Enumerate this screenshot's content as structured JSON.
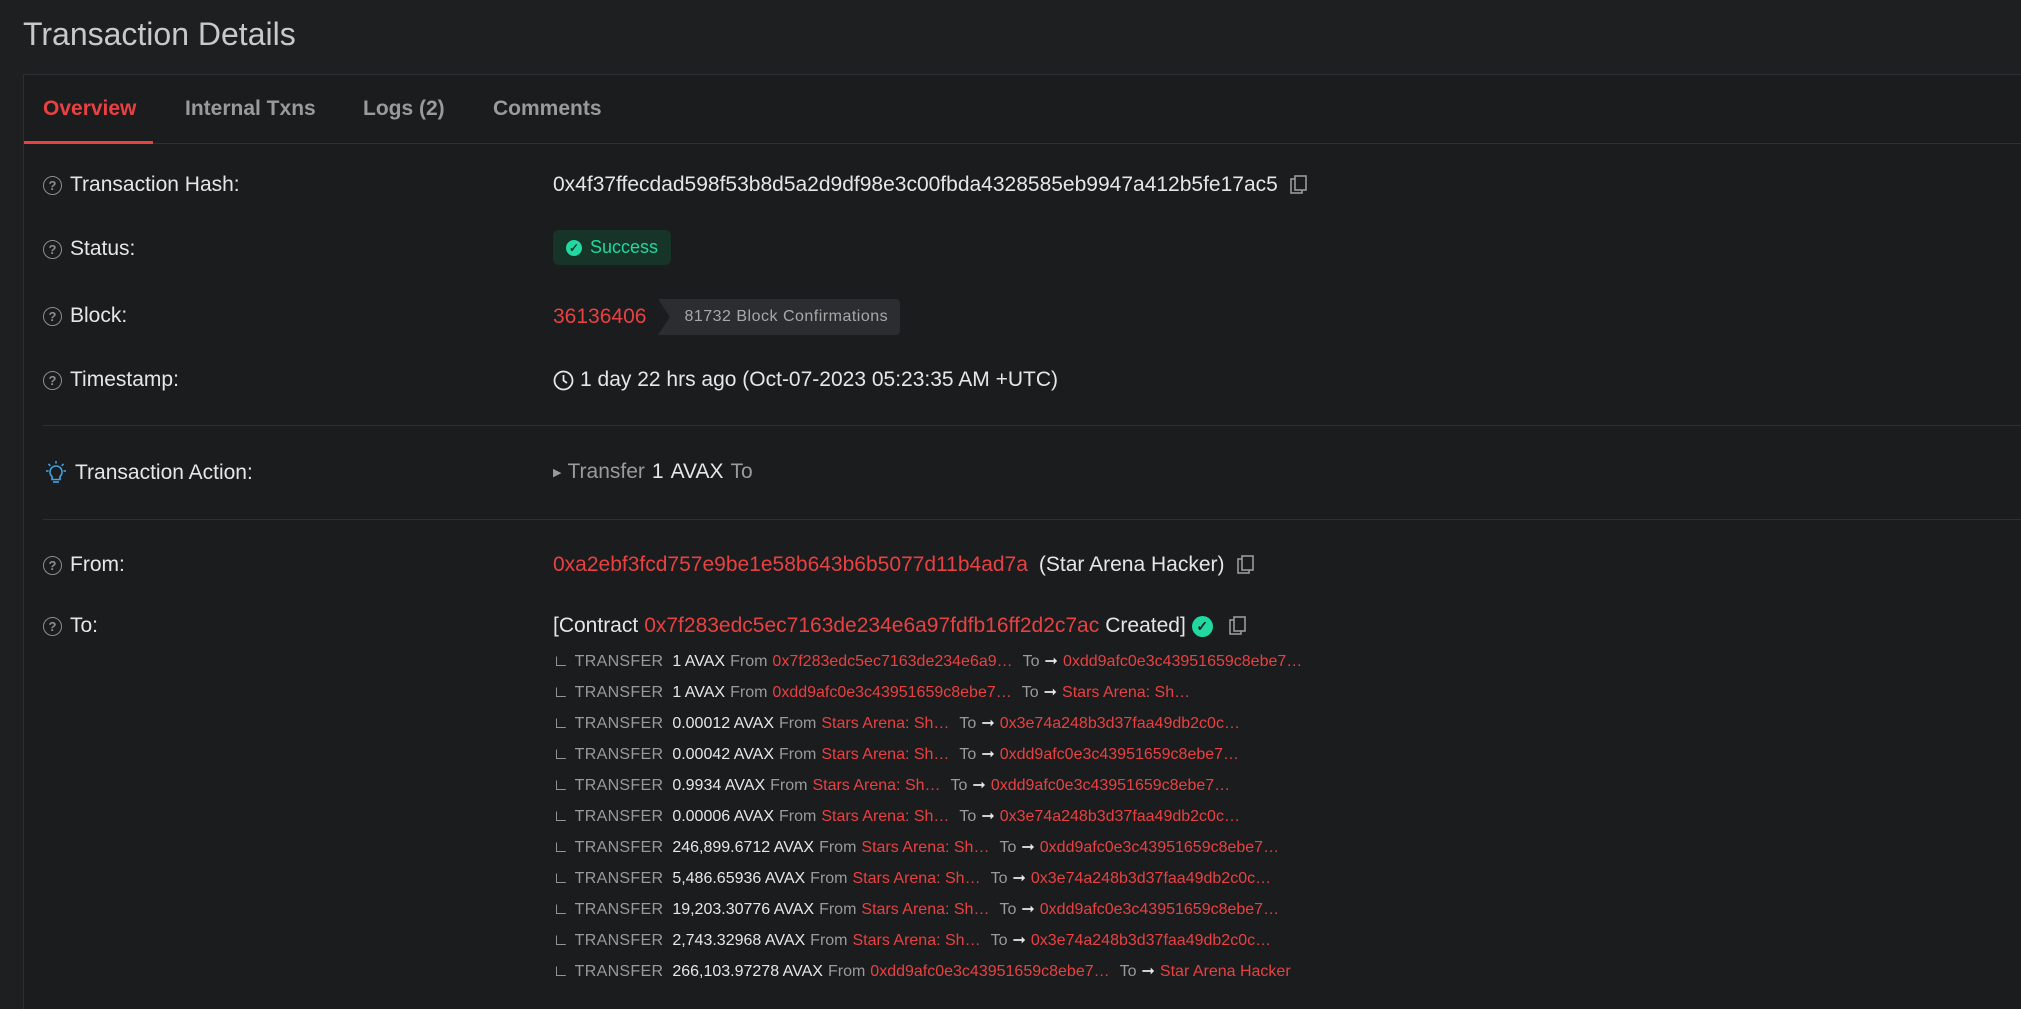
{
  "page": {
    "title": "Transaction Details"
  },
  "tabs": [
    {
      "label": "Overview"
    },
    {
      "label": "Internal Txns"
    },
    {
      "label": "Logs (2)"
    },
    {
      "label": "Comments"
    }
  ],
  "fields": {
    "hash": {
      "label": "Transaction Hash:",
      "value": "0x4f37ffecdad598f53b8d5a2d9df98e3c00fbda4328585eb9947a412b5fe17ac5"
    },
    "status": {
      "label": "Status:",
      "value": "Success"
    },
    "block": {
      "label": "Block:",
      "number": "36136406",
      "confirmations": "81732 Block Confirmations"
    },
    "timestamp": {
      "label": "Timestamp:",
      "value": "1 day 22 hrs ago (Oct-07-2023 05:23:35 AM +UTC)"
    },
    "action": {
      "label": "Transaction Action:",
      "verb": "Transfer",
      "amount": "1",
      "token": "AVAX",
      "to": "To"
    },
    "from": {
      "label": "From:",
      "address": "0xa2ebf3fcd757e9be1e58b643b6b5077d11b4ad7a",
      "name": "(Star Arena Hacker)"
    },
    "to": {
      "label": "To:",
      "prefix": "[Contract",
      "address": "0x7f283edc5ec7163de234e6a97fdfb16ff2d2c7ac",
      "suffix": "Created]"
    }
  },
  "transfers": [
    {
      "kind": "TRANSFER",
      "amount": "1 AVAX",
      "from": "0x7f283edc5ec7163de234e6a9…",
      "to": "0xdd9afc0e3c43951659c8ebe7…"
    },
    {
      "kind": "TRANSFER",
      "amount": "1 AVAX",
      "from": "0xdd9afc0e3c43951659c8ebe7…",
      "to": "Stars Arena: Sh…"
    },
    {
      "kind": "TRANSFER",
      "amount": "0.00012 AVAX",
      "from": "Stars Arena: Sh…",
      "to": "0x3e74a248b3d37faa49db2c0c…"
    },
    {
      "kind": "TRANSFER",
      "amount": "0.00042 AVAX",
      "from": "Stars Arena: Sh…",
      "to": "0xdd9afc0e3c43951659c8ebe7…"
    },
    {
      "kind": "TRANSFER",
      "amount": "0.9934 AVAX",
      "from": "Stars Arena: Sh…",
      "to": "0xdd9afc0e3c43951659c8ebe7…"
    },
    {
      "kind": "TRANSFER",
      "amount": "0.00006 AVAX",
      "from": "Stars Arena: Sh…",
      "to": "0x3e74a248b3d37faa49db2c0c…"
    },
    {
      "kind": "TRANSFER",
      "amount": "246,899.6712 AVAX",
      "from": "Stars Arena: Sh…",
      "to": "0xdd9afc0e3c43951659c8ebe7…"
    },
    {
      "kind": "TRANSFER",
      "amount": "5,486.65936 AVAX",
      "from": "Stars Arena: Sh…",
      "to": "0x3e74a248b3d37faa49db2c0c…"
    },
    {
      "kind": "TRANSFER",
      "amount": "19,203.30776 AVAX",
      "from": "Stars Arena: Sh…",
      "to": "0xdd9afc0e3c43951659c8ebe7…"
    },
    {
      "kind": "TRANSFER",
      "amount": "2,743.32968 AVAX",
      "from": "Stars Arena: Sh…",
      "to": "0x3e74a248b3d37faa49db2c0c…"
    },
    {
      "kind": "TRANSFER",
      "amount": "266,103.97278 AVAX",
      "from": "0xdd9afc0e3c43951659c8ebe7…",
      "to": "Star Arena Hacker"
    }
  ],
  "transfer_labels": {
    "from": "From",
    "to": "To",
    "arrow": "➞"
  },
  "colors": {
    "accent": "#e84142",
    "success": "#21d8a0",
    "background": "#1b1c1e"
  }
}
